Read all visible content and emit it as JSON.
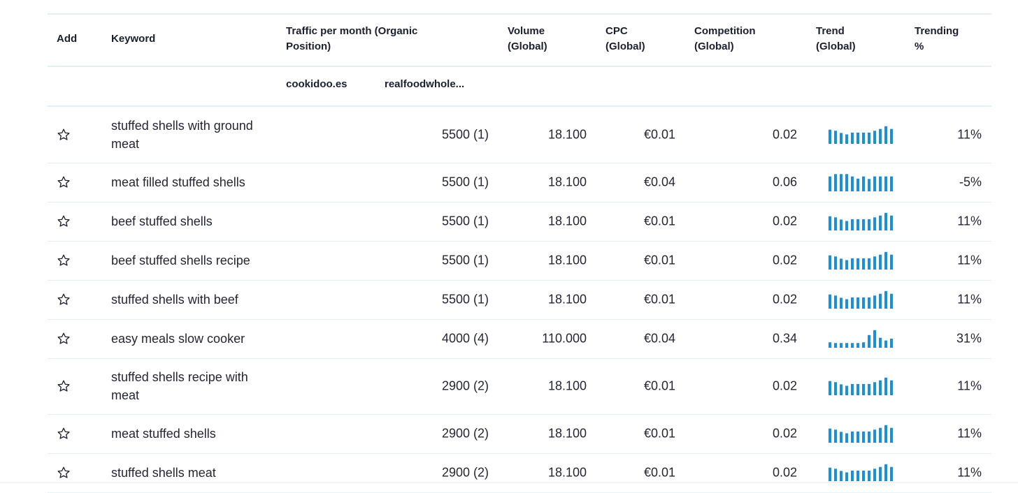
{
  "colors": {
    "bar": "#1a8ee0",
    "rule": "#e2eff4",
    "text": "#232735"
  },
  "headers": {
    "add": "Add",
    "keyword": "Keyword",
    "traffic_l1": "Traffic per month (Organic",
    "traffic_l2": "Position)",
    "volume_l1": "Volume",
    "volume_l2": "(Global)",
    "cpc_l1": "CPC",
    "cpc_l2": "(Global)",
    "competition_l1": "Competition",
    "competition_l2": "(Global)",
    "trend_l1": "Trend",
    "trend_l2": "(Global)",
    "trending_l1": "Trending",
    "trending_l2": "%"
  },
  "subheaders": {
    "site1": "cookidoo.es",
    "site2": "realfoodwhole..."
  },
  "rows": [
    {
      "keyword": "stuffed shells with ground meat",
      "traffic": "5500 (1)",
      "volume": "18.100",
      "cpc": "€0.01",
      "competition": "0.02",
      "trending": "11%",
      "trend": [
        0.78,
        0.72,
        0.6,
        0.52,
        0.62,
        0.62,
        0.62,
        0.62,
        0.72,
        0.82,
        0.97,
        0.82
      ]
    },
    {
      "keyword": "meat filled stuffed shells",
      "traffic": "5500 (1)",
      "volume": "18.100",
      "cpc": "€0.04",
      "competition": "0.06",
      "trending": "-5%",
      "trend": [
        0.82,
        0.95,
        0.95,
        0.95,
        0.82,
        0.7,
        0.82,
        0.68,
        0.82,
        0.82,
        0.82,
        0.82
      ]
    },
    {
      "keyword": "beef stuffed shells",
      "traffic": "5500 (1)",
      "volume": "18.100",
      "cpc": "€0.01",
      "competition": "0.02",
      "trending": "11%",
      "trend": [
        0.78,
        0.72,
        0.6,
        0.52,
        0.62,
        0.62,
        0.62,
        0.62,
        0.72,
        0.82,
        0.97,
        0.82
      ]
    },
    {
      "keyword": "beef stuffed shells recipe",
      "traffic": "5500 (1)",
      "volume": "18.100",
      "cpc": "€0.01",
      "competition": "0.02",
      "trending": "11%",
      "trend": [
        0.78,
        0.72,
        0.6,
        0.52,
        0.62,
        0.62,
        0.62,
        0.62,
        0.72,
        0.82,
        0.97,
        0.82
      ]
    },
    {
      "keyword": "stuffed shells with beef",
      "traffic": "5500 (1)",
      "volume": "18.100",
      "cpc": "€0.01",
      "competition": "0.02",
      "trending": "11%",
      "trend": [
        0.78,
        0.72,
        0.6,
        0.52,
        0.62,
        0.62,
        0.62,
        0.62,
        0.72,
        0.82,
        0.97,
        0.82
      ]
    },
    {
      "keyword": "easy meals slow cooker",
      "traffic": "4000 (4)",
      "volume": "110.000",
      "cpc": "€0.04",
      "competition": "0.34",
      "trending": "31%",
      "trend": [
        0.3,
        0.26,
        0.26,
        0.26,
        0.26,
        0.26,
        0.3,
        0.7,
        0.97,
        0.55,
        0.4,
        0.5
      ]
    },
    {
      "keyword": "stuffed shells recipe with meat",
      "traffic": "2900 (2)",
      "volume": "18.100",
      "cpc": "€0.01",
      "competition": "0.02",
      "trending": "11%",
      "trend": [
        0.78,
        0.72,
        0.6,
        0.52,
        0.62,
        0.62,
        0.62,
        0.62,
        0.72,
        0.82,
        0.97,
        0.82
      ]
    },
    {
      "keyword": "meat stuffed shells",
      "traffic": "2900 (2)",
      "volume": "18.100",
      "cpc": "€0.01",
      "competition": "0.02",
      "trending": "11%",
      "trend": [
        0.78,
        0.72,
        0.6,
        0.52,
        0.62,
        0.62,
        0.62,
        0.62,
        0.72,
        0.82,
        0.97,
        0.82
      ]
    },
    {
      "keyword": "stuffed shells meat",
      "traffic": "2900 (2)",
      "volume": "18.100",
      "cpc": "€0.01",
      "competition": "0.02",
      "trending": "11%",
      "trend": [
        0.78,
        0.72,
        0.6,
        0.52,
        0.62,
        0.62,
        0.62,
        0.62,
        0.72,
        0.82,
        0.97,
        0.82
      ]
    }
  ]
}
